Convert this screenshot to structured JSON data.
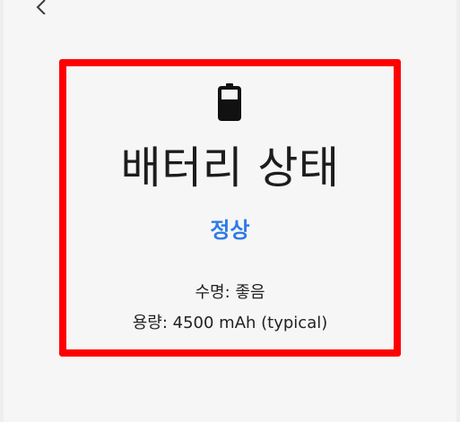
{
  "battery": {
    "title": "배터리 상태",
    "status": "정상",
    "status_color": "#2f7ae6",
    "health_line": "수명: 좋음",
    "capacity_line": "용량: 4500 mAh (typical)",
    "level_fill_fraction": 0.65
  },
  "icons": {
    "back": "back-arrow-icon",
    "battery": "battery-icon"
  },
  "colors": {
    "background": "#f6f6f6",
    "highlight": "#ff0000",
    "text": "#1d1d1d"
  }
}
